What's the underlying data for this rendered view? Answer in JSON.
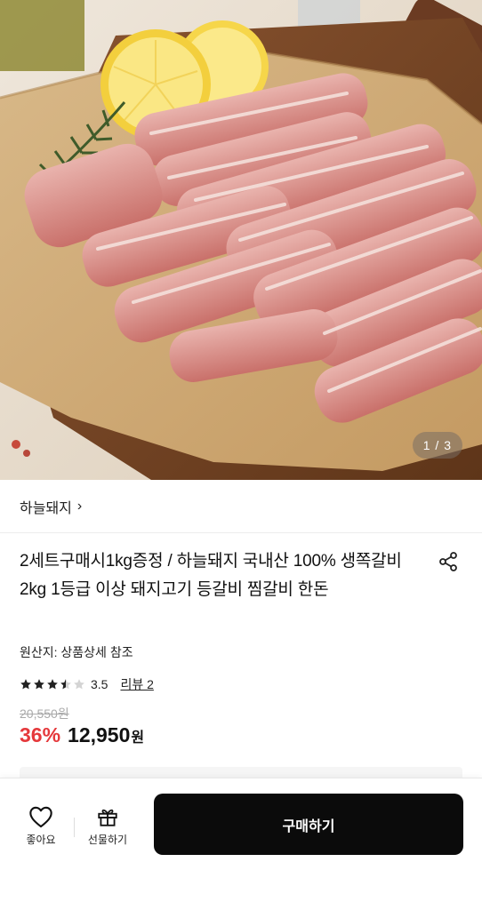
{
  "hero": {
    "page_current": "1",
    "page_separator": "/",
    "page_total": "3"
  },
  "store": {
    "name": "하늘돼지",
    "chevron": "›"
  },
  "product": {
    "title": "2세트구매시1kg증정 / 하늘돼지 국내산 100% 생쪽갈비 2kg 1등급 이상 돼지고기 등갈비 찜갈비 한돈",
    "origin": "원산지: 상품상세 참조",
    "rating": 3.5,
    "rating_text": "3.5",
    "review_text": "리뷰 2",
    "original_price": "20,550원",
    "discount": "36%",
    "price": "12,950",
    "currency": "원"
  },
  "bottom_bar": {
    "like_label": "좋아요",
    "gift_label": "선물하기",
    "buy_label": "구매하기"
  },
  "colors": {
    "discount": "#e5383b",
    "buy_button": "#0b0b0b"
  }
}
